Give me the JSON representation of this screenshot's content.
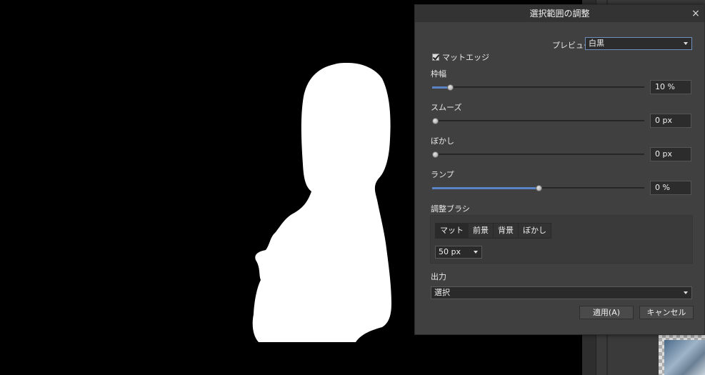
{
  "dialog": {
    "title": "選択範囲の調整",
    "close_label": "×",
    "preview": {
      "label": "プレビュー",
      "value": "白黒"
    },
    "matte_edges": {
      "label": "マットエッジ",
      "checked": true
    },
    "sliders": [
      {
        "label": "枠幅",
        "value": "10 %",
        "fraction": 0.085
      },
      {
        "label": "スムーズ",
        "value": "0 px",
        "fraction": 0.0
      },
      {
        "label": "ぼかし",
        "value": "0 px",
        "fraction": 0.0
      },
      {
        "label": "ランプ",
        "value": "0 %",
        "fraction": 0.5
      }
    ],
    "brush": {
      "label": "調整ブラシ",
      "modes": [
        "マット",
        "前景",
        "背景",
        "ぼかし"
      ],
      "active_mode": "マット",
      "size": "50 px"
    },
    "output": {
      "label": "出力",
      "value": "選択"
    },
    "apply_label": "適用(A)",
    "cancel_label": "キャンセル"
  },
  "colors": {
    "accent": "#5a84c5",
    "dialog_bg": "#404040",
    "canvas_bg": "#000000"
  }
}
